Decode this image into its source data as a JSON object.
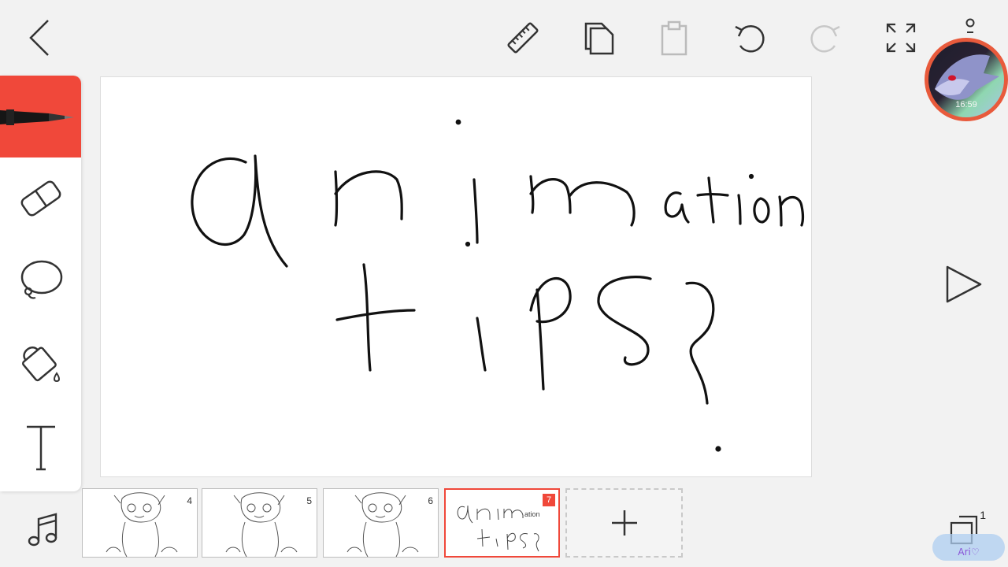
{
  "toolbar": {
    "icons": [
      "back-icon",
      "ruler-icon",
      "copy-icon",
      "paste-icon",
      "undo-icon",
      "redo-icon",
      "fullscreen-icon",
      "more-icon"
    ]
  },
  "status": {
    "time": "16:59"
  },
  "tools": {
    "items": [
      "pen",
      "eraser",
      "lasso",
      "fill",
      "text"
    ],
    "selected": "pen"
  },
  "canvas": {
    "drawing_text": [
      "animation",
      "tips?"
    ]
  },
  "frames": [
    {
      "number": "4",
      "selected": false
    },
    {
      "number": "5",
      "selected": false
    },
    {
      "number": "6",
      "selected": false
    },
    {
      "number": "7",
      "selected": true
    }
  ],
  "layers": {
    "count": "1"
  },
  "watermark": {
    "text": "Ari♡"
  },
  "colors": {
    "accent": "#f0483a",
    "background": "#f2f2f2",
    "canvas": "#ffffff"
  }
}
